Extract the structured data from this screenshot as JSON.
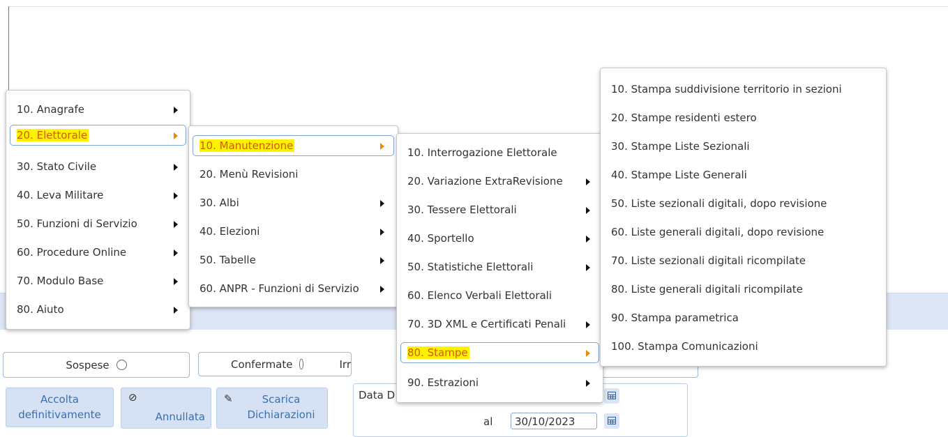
{
  "filters": {
    "sospese": "Sospese",
    "confermate": "Confermate",
    "third_partial": "Irr"
  },
  "buttons": {
    "accolta": "Accolta definitivamente",
    "annullata": "Annullata",
    "scarica": "Scarica Dichiarazioni"
  },
  "date_panel": {
    "label_partial": "Data D",
    "al_label": "al",
    "al_value": "30/10/2023"
  },
  "menu1": {
    "items": [
      {
        "label": "10. Anagrafe"
      },
      {
        "label": "20. Elettorale"
      },
      {
        "label": "30. Stato Civile"
      },
      {
        "label": "40. Leva Militare"
      },
      {
        "label": "50. Funzioni di Servizio"
      },
      {
        "label": "60. Procedure Online"
      },
      {
        "label": "70. Modulo Base"
      },
      {
        "label": "80. Aiuto"
      }
    ]
  },
  "menu2": {
    "items": [
      {
        "label": "10. Manutenzione"
      },
      {
        "label": "20. Menù Revisioni"
      },
      {
        "label": "30. Albi"
      },
      {
        "label": "40. Elezioni"
      },
      {
        "label": "50. Tabelle"
      },
      {
        "label": "60. ANPR - Funzioni di Servizio"
      }
    ]
  },
  "menu3": {
    "items": [
      {
        "label": "10. Interrogazione Elettorale"
      },
      {
        "label": "20. Variazione ExtraRevisione"
      },
      {
        "label": "30. Tessere Elettorali"
      },
      {
        "label": "40. Sportello"
      },
      {
        "label": "50. Statistiche Elettorali"
      },
      {
        "label": "60. Elenco Verbali Elettorali"
      },
      {
        "label": "70. 3D XML e Certificati Penali"
      },
      {
        "label": "80. Stampe"
      },
      {
        "label": "90. Estrazioni"
      }
    ]
  },
  "menu4": {
    "items": [
      {
        "label": "10. Stampa suddivisione territorio in sezioni"
      },
      {
        "label": "20. Stampe residenti estero"
      },
      {
        "label": "30. Stampe Liste Sezionali"
      },
      {
        "label": "40. Stampe Liste Generali"
      },
      {
        "label": "50. Liste sezionali digitali, dopo revisione"
      },
      {
        "label": "60. Liste generali digitali, dopo revisione"
      },
      {
        "label": "70. Liste sezionali digitali ricompilate"
      },
      {
        "label": "80. Liste generali digitali ricompilate"
      },
      {
        "label": "90. Stampa parametrica"
      },
      {
        "label": "100. Stampa Comunicazioni"
      }
    ]
  },
  "colors": {
    "highlight": "#fff200",
    "active_text": "#d35a00",
    "submenu_arrow_active": "#f08a00",
    "button_text": "#3a6fb0",
    "band": "#dde6f5"
  },
  "icons": {
    "submenu": "caret-right-icon",
    "annullata": "ban-icon",
    "scarica": "pencil-icon",
    "date": "calendar-icon",
    "radio": "radio-icon"
  }
}
